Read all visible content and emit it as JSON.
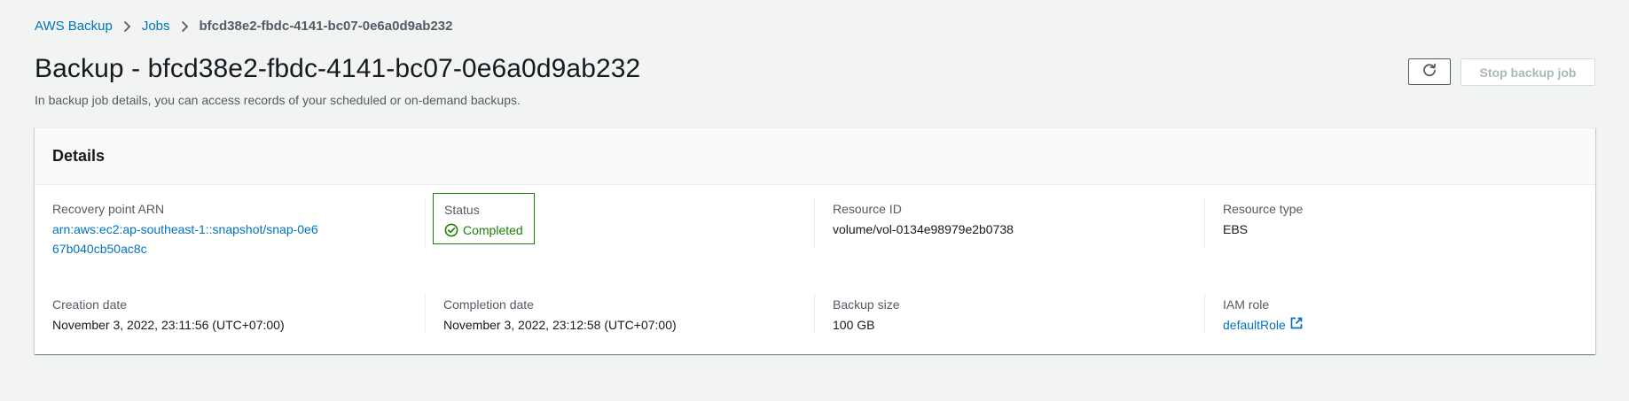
{
  "breadcrumb": {
    "items": [
      "AWS Backup",
      "Jobs"
    ],
    "current": "bfcd38e2-fbdc-4141-bc07-0e6a0d9ab232"
  },
  "header": {
    "title": "Backup - bfcd38e2-fbdc-4141-bc07-0e6a0d9ab232",
    "description": "In backup job details, you can access records of your scheduled or on-demand backups.",
    "stop_button_label": "Stop backup job"
  },
  "details": {
    "title": "Details",
    "recovery_point_arn": {
      "label": "Recovery point ARN",
      "value": "arn:aws:ec2:ap-southeast-1::snapshot/snap-0e667b040cb50ac8c"
    },
    "status": {
      "label": "Status",
      "value": "Completed"
    },
    "resource_id": {
      "label": "Resource ID",
      "value": "volume/vol-0134e98979e2b0738"
    },
    "resource_type": {
      "label": "Resource type",
      "value": "EBS"
    },
    "creation_date": {
      "label": "Creation date",
      "value": "November 3, 2022, 23:11:56 (UTC+07:00)"
    },
    "completion_date": {
      "label": "Completion date",
      "value": "November 3, 2022, 23:12:58 (UTC+07:00)"
    },
    "backup_size": {
      "label": "Backup size",
      "value": "100 GB"
    },
    "iam_role": {
      "label": "IAM role",
      "value": "defaultRole"
    }
  },
  "colors": {
    "link": "#0073bb",
    "success": "#1d8102",
    "background": "#f2f3f3",
    "disabled_text": "#aab7b8"
  },
  "icons": [
    "chevron-right-icon",
    "refresh-icon",
    "status-success-icon",
    "external-link-icon"
  ]
}
